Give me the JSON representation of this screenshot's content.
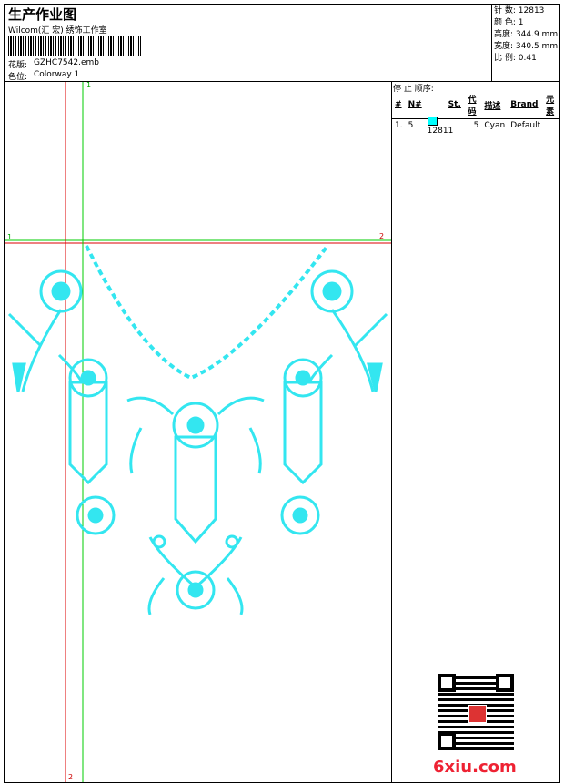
{
  "header": {
    "title": "生产作业图",
    "subtitle": "Wilcom(汇 宏) 绣饰工作室",
    "pattern_label": "花版:",
    "pattern_value": "GZHC7542.emb",
    "colorway_label": "色位:",
    "colorway_value": "Colorway 1"
  },
  "stats": [
    {
      "label": "针 数:",
      "value": "12813"
    },
    {
      "label": "颜 色:",
      "value": "1"
    },
    {
      "label": "高度:",
      "value": "344.9 mm"
    },
    {
      "label": "宽度:",
      "value": "340.5 mm"
    },
    {
      "label": "比 例:",
      "value": "0.41"
    }
  ],
  "stop_sequence": {
    "title": "停 止 顺序:",
    "columns": [
      "#",
      "N#",
      "St.",
      "代码",
      "描述",
      "Brand",
      "元素"
    ],
    "rows": [
      {
        "index": "1.",
        "needle": "5",
        "stitches": "12811",
        "code": "5",
        "description": "Cyan",
        "brand": "Default",
        "swatch_color": "#00ffff"
      }
    ]
  },
  "guides": {
    "h_left": "1",
    "h_right": "2",
    "v_top": "1",
    "v_bottom": "2"
  },
  "watermark": "6xiu.com",
  "colors": {
    "thread": "#33e6f0",
    "guide_green": "#00cc00",
    "guide_red": "#dd0000"
  }
}
